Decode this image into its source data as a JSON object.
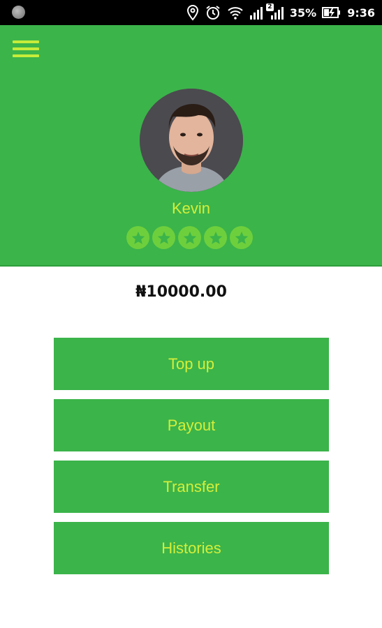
{
  "status_bar": {
    "battery_percent": "35%",
    "time": "9:36",
    "notification_badge": "2",
    "icons": [
      "notification-dot-icon",
      "location-icon",
      "alarm-icon",
      "wifi-icon",
      "signal-icon",
      "signal-icon",
      "battery-charging-icon"
    ]
  },
  "header": {
    "menu_icon": "hamburger-menu-icon",
    "user_name": "Kevin",
    "rating_stars": 5,
    "star_icon": "star-icon"
  },
  "wallet": {
    "balance": "₦10000.00"
  },
  "actions": [
    {
      "label": "Top up"
    },
    {
      "label": "Payout"
    },
    {
      "label": "Transfer"
    },
    {
      "label": "Histories"
    }
  ],
  "colors": {
    "primary_green": "#3bb44a",
    "accent_yellow": "#d4ee3a",
    "star_green": "#6ecf3c"
  }
}
